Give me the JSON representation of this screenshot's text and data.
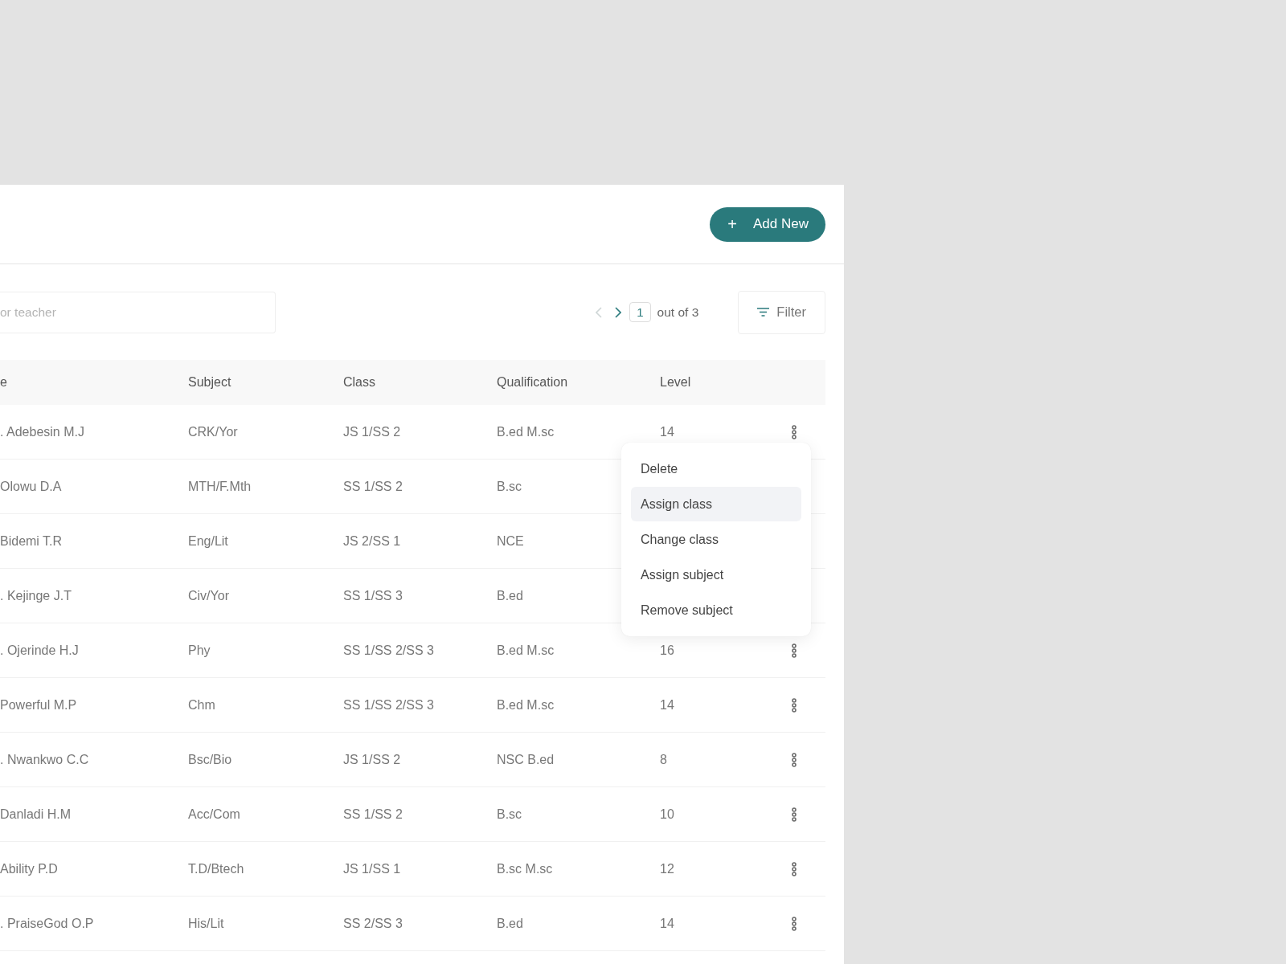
{
  "header": {
    "add_button": {
      "icon": "+",
      "label": "Add New"
    }
  },
  "toolbar": {
    "search": {
      "placeholder": "or teacher"
    },
    "pagination": {
      "previous_disabled": true,
      "next_disabled": false,
      "page": "1",
      "total": "out of 3"
    },
    "filter_button": "Filter"
  },
  "table": {
    "columns": [
      "e",
      "Subject",
      "Class",
      "Qualification",
      "Level"
    ],
    "rows": [
      {
        "name": ". Adebesin M.J",
        "subject": "CRK/Yor",
        "class": "JS 1/SS 2",
        "qualification": "B.ed M.sc",
        "level": "14",
        "menu_button": true
      },
      {
        "name": "Olowu D.A",
        "subject": "MTH/F.Mth",
        "class": "SS 1/SS 2",
        "qualification": "B.sc",
        "menu_button": false
      },
      {
        "name": "Bidemi T.R",
        "subject": "Eng/Lit",
        "class": "JS 2/SS 1",
        "qualification": "NCE",
        "menu_button": false
      },
      {
        "name": ". Kejinge J.T",
        "subject": "Civ/Yor",
        "class": "SS 1/SS 3",
        "qualification": "B.ed",
        "menu_button": false
      },
      {
        "name": ". Ojerinde H.J",
        "subject": "Phy",
        "class": "SS 1/SS 2/SS 3",
        "qualification": "B.ed M.sc",
        "level": "16",
        "menu_button": true
      },
      {
        "name": "Powerful M.P",
        "subject": "Chm",
        "class": "SS 1/SS 2/SS 3",
        "qualification": "B.ed M.sc",
        "level": "14",
        "menu_button": true
      },
      {
        "name": ". Nwankwo C.C",
        "subject": "Bsc/Bio",
        "class": "JS 1/SS 2",
        "qualification": "NSC B.ed",
        "level": "8",
        "menu_button": true
      },
      {
        "name": "Danladi H.M",
        "subject": "Acc/Com",
        "class": "SS 1/SS 2",
        "qualification": "B.sc",
        "level": "10",
        "menu_button": true
      },
      {
        "name": "Ability P.D",
        "subject": "T.D/Btech",
        "class": "JS 1/SS 1",
        "qualification": "B.sc M.sc",
        "level": "12",
        "menu_button": true
      },
      {
        "name": ". PraiseGod O.P",
        "subject": "His/Lit",
        "class": "SS 2/SS 3",
        "qualification": "B.ed",
        "level": "14",
        "menu_button": true
      }
    ]
  },
  "menu": {
    "items": [
      {
        "label": "Delete",
        "selected": false
      },
      {
        "label": "Assign class",
        "selected": true
      },
      {
        "label": "Change class",
        "selected": false
      },
      {
        "label": "Assign subject",
        "selected": false
      },
      {
        "label": "Remove subject",
        "selected": false
      }
    ]
  }
}
